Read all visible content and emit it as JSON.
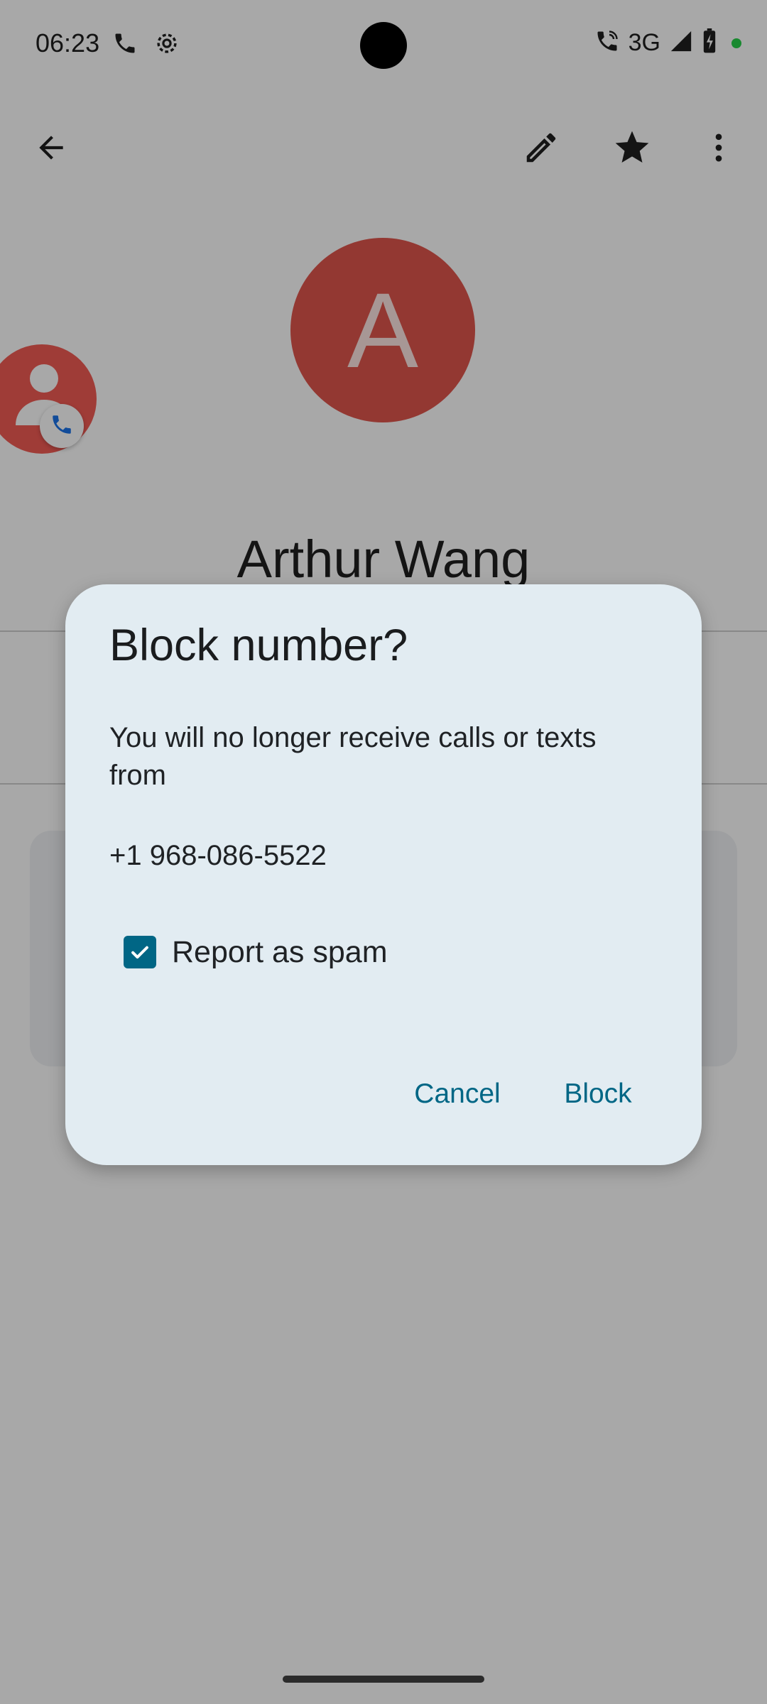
{
  "status_bar": {
    "time": "06:23",
    "network": "3G",
    "icons": [
      "phone-icon",
      "settings-gear-icon",
      "wifi-call-icon",
      "signal-icon",
      "battery-charging-icon"
    ]
  },
  "app_bar": {
    "icons": [
      "back-arrow-icon",
      "edit-pencil-icon",
      "star-icon",
      "more-vert-icon"
    ]
  },
  "contact": {
    "avatar_letter": "A",
    "name": "Arthur Wang"
  },
  "dialog": {
    "title": "Block number?",
    "message": "You will no longer receive calls or texts from",
    "number": "+1 968-086-5522",
    "checkbox_label": "Report as spam",
    "checkbox_checked": true,
    "cancel_label": "Cancel",
    "block_label": "Block"
  },
  "colors": {
    "accent": "#006685",
    "dialog_bg": "#e2ecf2",
    "avatar_bg": "#e0564d"
  }
}
